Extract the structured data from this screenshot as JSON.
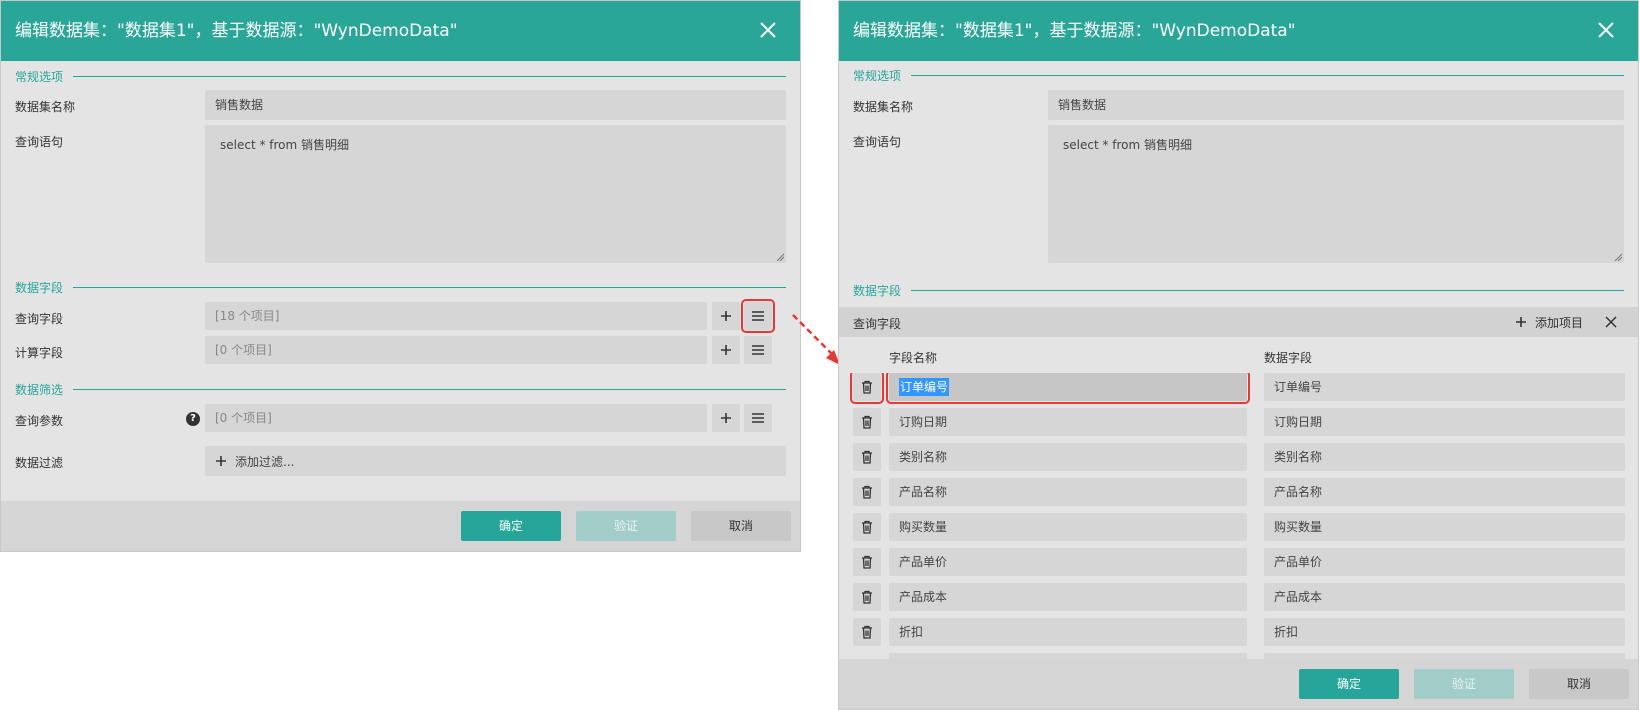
{
  "left_dialog": {
    "title": "编辑数据集：\"数据集1\"，基于数据源：\"WynDemoData\"",
    "sections": {
      "general": "常规选项",
      "fields": "数据字段",
      "filter": "数据筛选"
    },
    "dataset_name_label": "数据集名称",
    "dataset_name_value": "销售数据",
    "query_label": "查询语句",
    "query_value": "select * from 销售明细",
    "query_fields_label": "查询字段",
    "query_fields_value": "[18 个项目]",
    "calc_fields_label": "计算字段",
    "calc_fields_value": "[0 个项目]",
    "query_params_label": "查询参数",
    "query_params_value": "[0 个项目]",
    "data_filter_label": "数据过滤",
    "add_filter_label": "添加过滤...",
    "buttons": {
      "ok": "确定",
      "validate": "验证",
      "cancel": "取消"
    }
  },
  "right_dialog": {
    "title": "编辑数据集：\"数据集1\"，基于数据源：\"WynDemoData\"",
    "sections": {
      "general": "常规选项",
      "fields": "数据字段"
    },
    "dataset_name_label": "数据集名称",
    "dataset_name_value": "销售数据",
    "query_label": "查询语句",
    "query_value": "select * from 销售明细",
    "query_fields_label": "查询字段",
    "add_item_label": "添加项目",
    "col_field_name": "字段名称",
    "col_data_field": "数据字段",
    "rows": [
      {
        "name": "订单编号",
        "data": "订单编号",
        "selected": true
      },
      {
        "name": "订购日期",
        "data": "订购日期"
      },
      {
        "name": "类别名称",
        "data": "类别名称"
      },
      {
        "name": "产品名称",
        "data": "产品名称"
      },
      {
        "name": "购买数量",
        "data": "购买数量"
      },
      {
        "name": "产品单价",
        "data": "产品单价"
      },
      {
        "name": "产品成本",
        "data": "产品成本"
      },
      {
        "name": "折扣",
        "data": "折扣"
      }
    ],
    "buttons": {
      "ok": "确定",
      "validate": "验证",
      "cancel": "取消"
    }
  },
  "colors": {
    "accent": "#2aa698",
    "highlight": "#e53935",
    "selection": "#3297fd"
  }
}
